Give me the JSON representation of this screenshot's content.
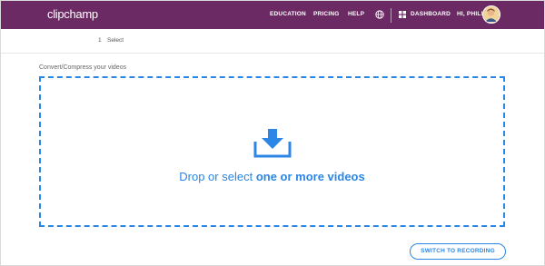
{
  "header": {
    "logo_text": "clipchamp",
    "nav": {
      "education": "EDUCATION",
      "pricing": "PRICING",
      "help": "HELP",
      "dashboard": "DASHBOARD",
      "greeting": "HI, PHIL!"
    },
    "icons": [
      "globe-icon",
      "grid-icon",
      "avatar"
    ],
    "background_color": "#6b2a63"
  },
  "steps": {
    "number": "1",
    "label": "Select"
  },
  "section_title": "Convert/Compress your videos",
  "dropzone": {
    "text_prefix": "Drop or select ",
    "text_emphasis": "one or more videos",
    "icon": "download-icon",
    "accent_color": "#2b86e6"
  },
  "footer": {
    "switch_label": "SWITCH TO RECORDING"
  }
}
